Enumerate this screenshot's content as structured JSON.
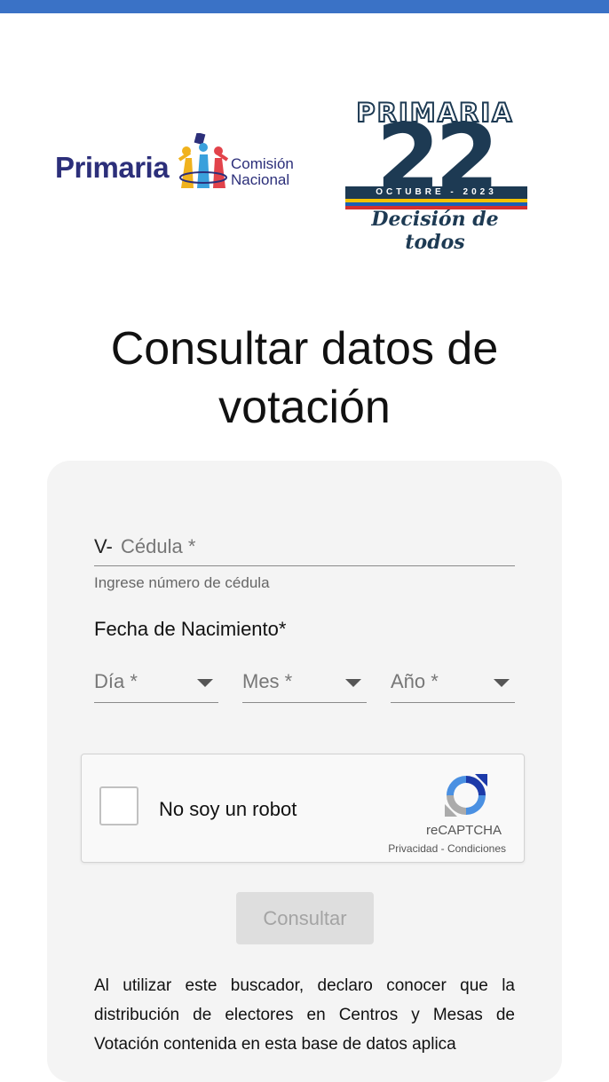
{
  "colors": {
    "topbar": "#3a72c6",
    "logo_navy": "#2c2f7a",
    "primaria22_navy": "#1d3a53",
    "card_bg": "#f4f4f4",
    "button_bg": "#dedede",
    "button_text": "#a4a4a4"
  },
  "logos": {
    "left": {
      "word": "Primaria",
      "sub_line1": "Comisión",
      "sub_line2": "Nacional"
    },
    "right": {
      "title": "PRIMARIA",
      "number": "22",
      "date": "OCTUBRE - 2023",
      "slogan": "Decisión de todos"
    }
  },
  "page": {
    "title": "Consultar datos de votación"
  },
  "form": {
    "cedula": {
      "prefix": "V-",
      "placeholder": "Cédula *",
      "value": "",
      "hint": "Ingrese número de cédula"
    },
    "fecha_label": "Fecha de Nacimiento*",
    "dia_placeholder": "Día *",
    "mes_placeholder": "Mes *",
    "anio_placeholder": "Año *",
    "recaptcha": {
      "label": "No soy un robot",
      "brand": "reCAPTCHA",
      "privacy": "Privacidad",
      "separator": " - ",
      "terms": "Condiciones",
      "checked": false
    },
    "submit_label": "Consultar",
    "disclaimer": "Al utilizar este buscador, declaro conocer que la distribución de electores en Centros y Mesas de Votación contenida en esta base de datos aplica"
  }
}
